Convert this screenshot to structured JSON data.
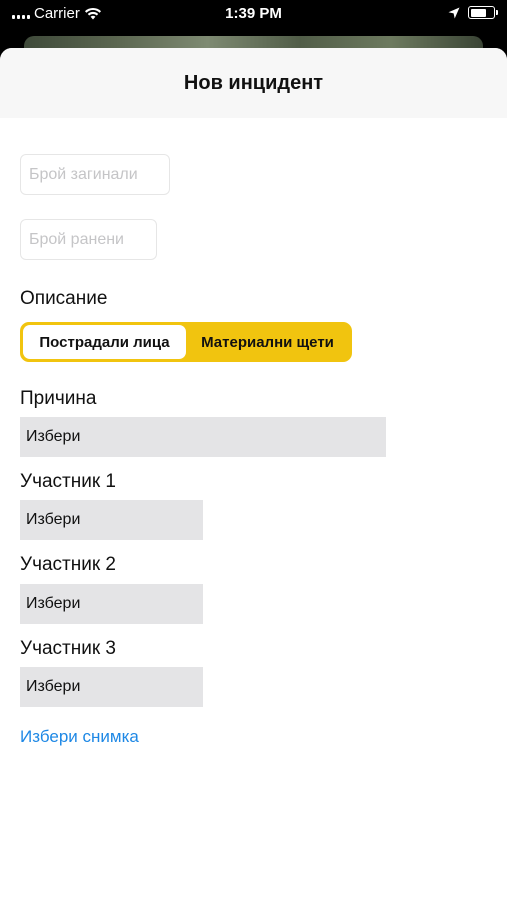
{
  "status_bar": {
    "carrier": "Carrier",
    "time": "1:39 PM"
  },
  "sheet": {
    "title": "Нов инцидент"
  },
  "fields": {
    "dead_placeholder": "Брой загинали",
    "injured_placeholder": "Брой ранени"
  },
  "description": {
    "label": "Описание",
    "segments": [
      "Пострадали лица",
      "Материални щети"
    ],
    "selected": "Пострадали лица",
    "accent_color": "#f1c40f"
  },
  "cause": {
    "label": "Причина",
    "value": "Избери"
  },
  "participants": [
    {
      "label": "Участник 1",
      "value": "Избери"
    },
    {
      "label": "Участник 2",
      "value": "Избери"
    },
    {
      "label": "Участник 3",
      "value": "Избери"
    }
  ],
  "photo_link": "Избери снимка",
  "link_color": "#1e88e5"
}
